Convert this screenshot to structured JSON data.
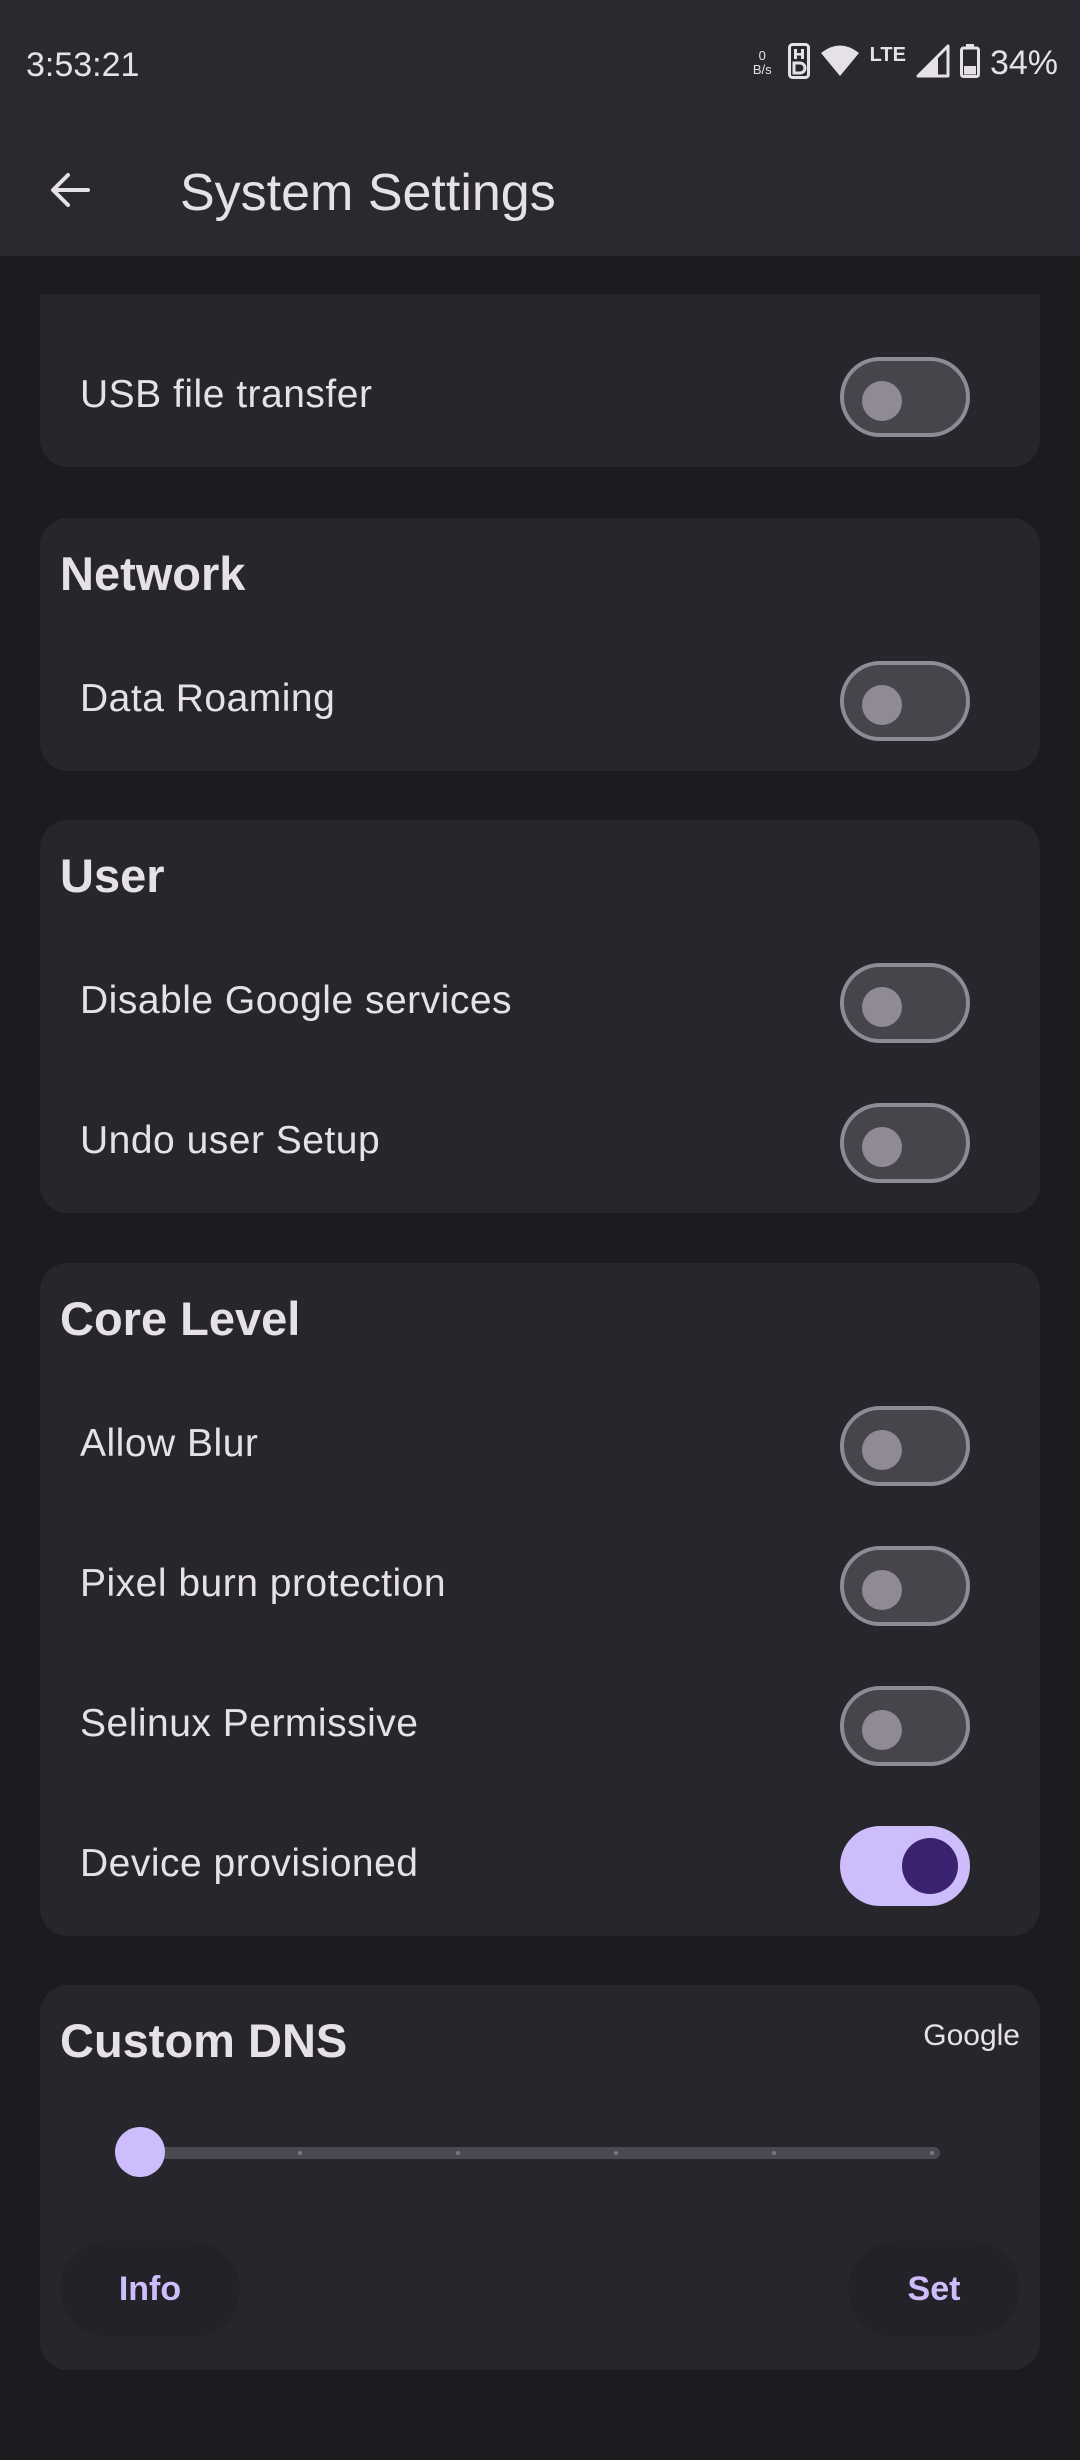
{
  "status_bar": {
    "time": "3:53:21",
    "net_speed_value": "0",
    "net_speed_unit": "B/s",
    "network_type": "LTE",
    "battery": "34%",
    "icons": [
      "hd-icon",
      "wifi-icon",
      "lte-icon",
      "signal-icon",
      "battery-icon"
    ]
  },
  "app_bar": {
    "back_icon": "arrow-left-icon",
    "title": "System Settings"
  },
  "sections": {
    "usb": {
      "items": [
        {
          "label": "USB file transfer",
          "checked": false
        }
      ]
    },
    "network": {
      "title": "Network",
      "items": [
        {
          "label": "Data Roaming",
          "checked": false
        }
      ]
    },
    "user": {
      "title": "User",
      "items": [
        {
          "label": "Disable Google services",
          "checked": false
        },
        {
          "label": "Undo user Setup",
          "checked": false
        }
      ]
    },
    "core": {
      "title": "Core Level",
      "items": [
        {
          "label": "Allow Blur",
          "checked": false
        },
        {
          "label": "Pixel burn protection",
          "checked": false
        },
        {
          "label": "Selinux Permissive",
          "checked": false
        },
        {
          "label": "Device provisioned",
          "checked": true
        }
      ]
    },
    "dns": {
      "title": "Custom DNS",
      "provider": "Google",
      "slider_value": 0,
      "slider_max": 5,
      "info_label": "Info",
      "set_label": "Set"
    }
  },
  "colors": {
    "background": "#1c1b20",
    "surface": "#27262c",
    "bar": "#2a2930",
    "accent": "#cdbdfa",
    "accent_dark": "#3a2270",
    "text": "#e6e1e9"
  }
}
